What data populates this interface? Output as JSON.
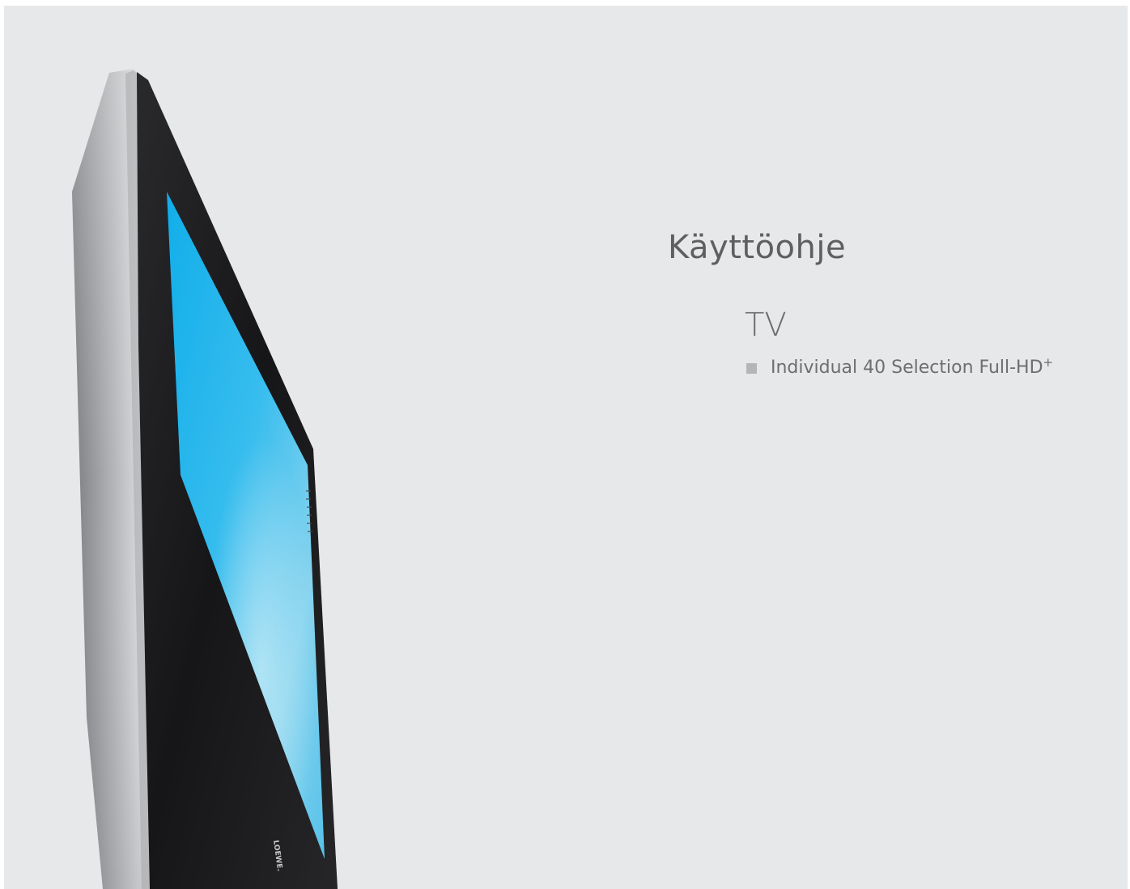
{
  "document": {
    "title": "Käyttöohje",
    "category": "TV",
    "model": "Individual 40 Selection Full-HD",
    "model_superscript": "+"
  },
  "illustration": {
    "icon": "flat-screen-tv-icon",
    "brand_logo_text": "LOEWE.",
    "screen_color": "#2ab8ec",
    "frame_color": "#c9cacc",
    "bezel_color": "#1b1b1d",
    "background_color": "#e7e8ea"
  }
}
